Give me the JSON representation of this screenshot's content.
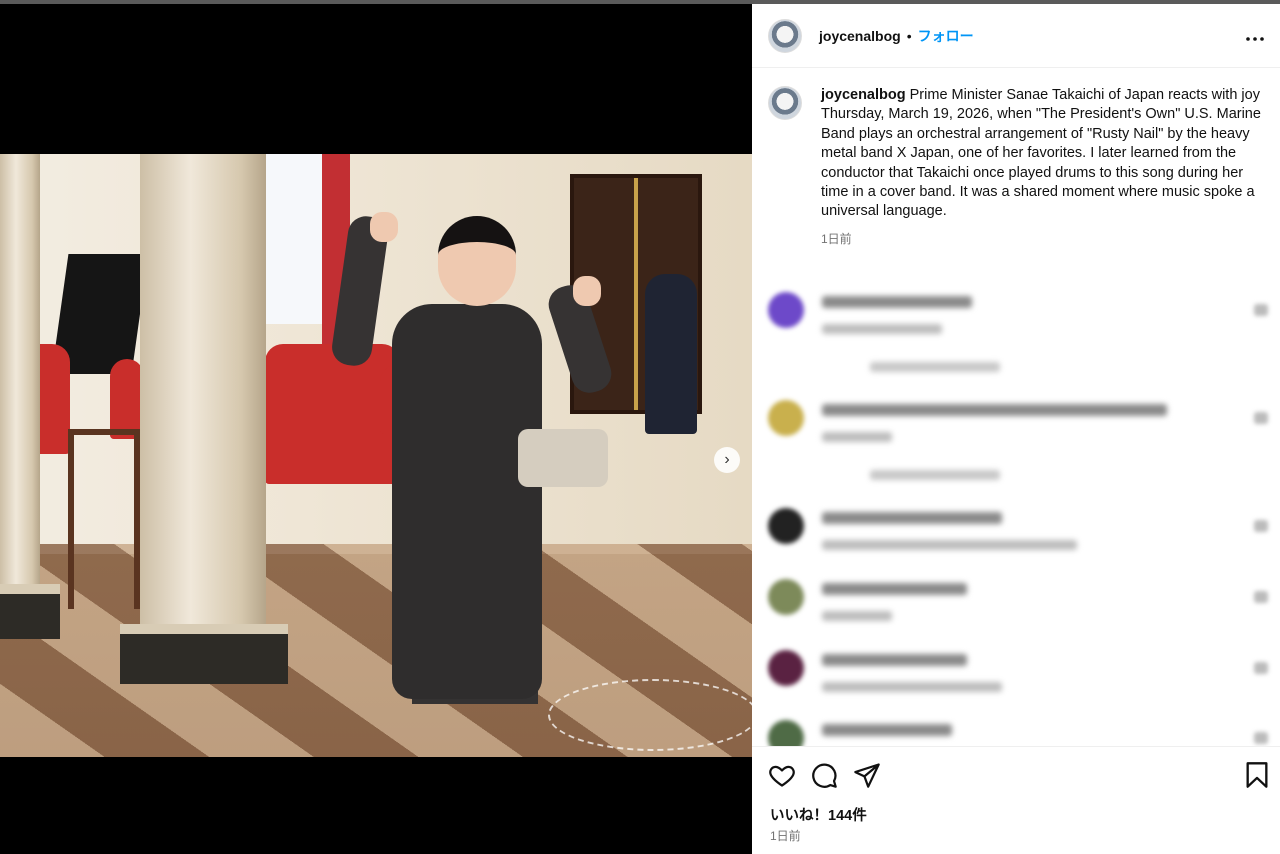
{
  "post": {
    "username": "joycenalbog",
    "separator": "•",
    "follow_label": "フォロー",
    "more_label": "•••",
    "caption_username": "joycenalbog",
    "caption_text": " Prime Minister Sanae Takaichi of Japan reacts with joy Thursday, March 19, 2026, when \"The President's Own\" U.S. Marine Band plays an orchestral arrangement of \"Rusty Nail\" by the heavy metal band X Japan, one of her favorites. I later learned from the conductor that Takaichi once played drums to this song during her time in a cover band. It was a shared moment where music spoke a universal language.",
    "caption_time": "1日前",
    "likes_label": "いいね！144件",
    "footer_time": "1日前"
  },
  "carousel": {
    "current_index": 1,
    "total": 3,
    "next_icon": "chevron-right-icon",
    "next_glyph": "›"
  },
  "actions": {
    "like_icon": "heart-icon",
    "comment_icon": "comment-icon",
    "share_icon": "share-icon",
    "save_icon": "bookmark-icon"
  },
  "comments_note": "Comment contents are blurred and unreadable in the screenshot",
  "colors": {
    "accent": "#0095f6",
    "text": "#111111",
    "muted": "#737373",
    "band_red": "#c92e2b"
  }
}
